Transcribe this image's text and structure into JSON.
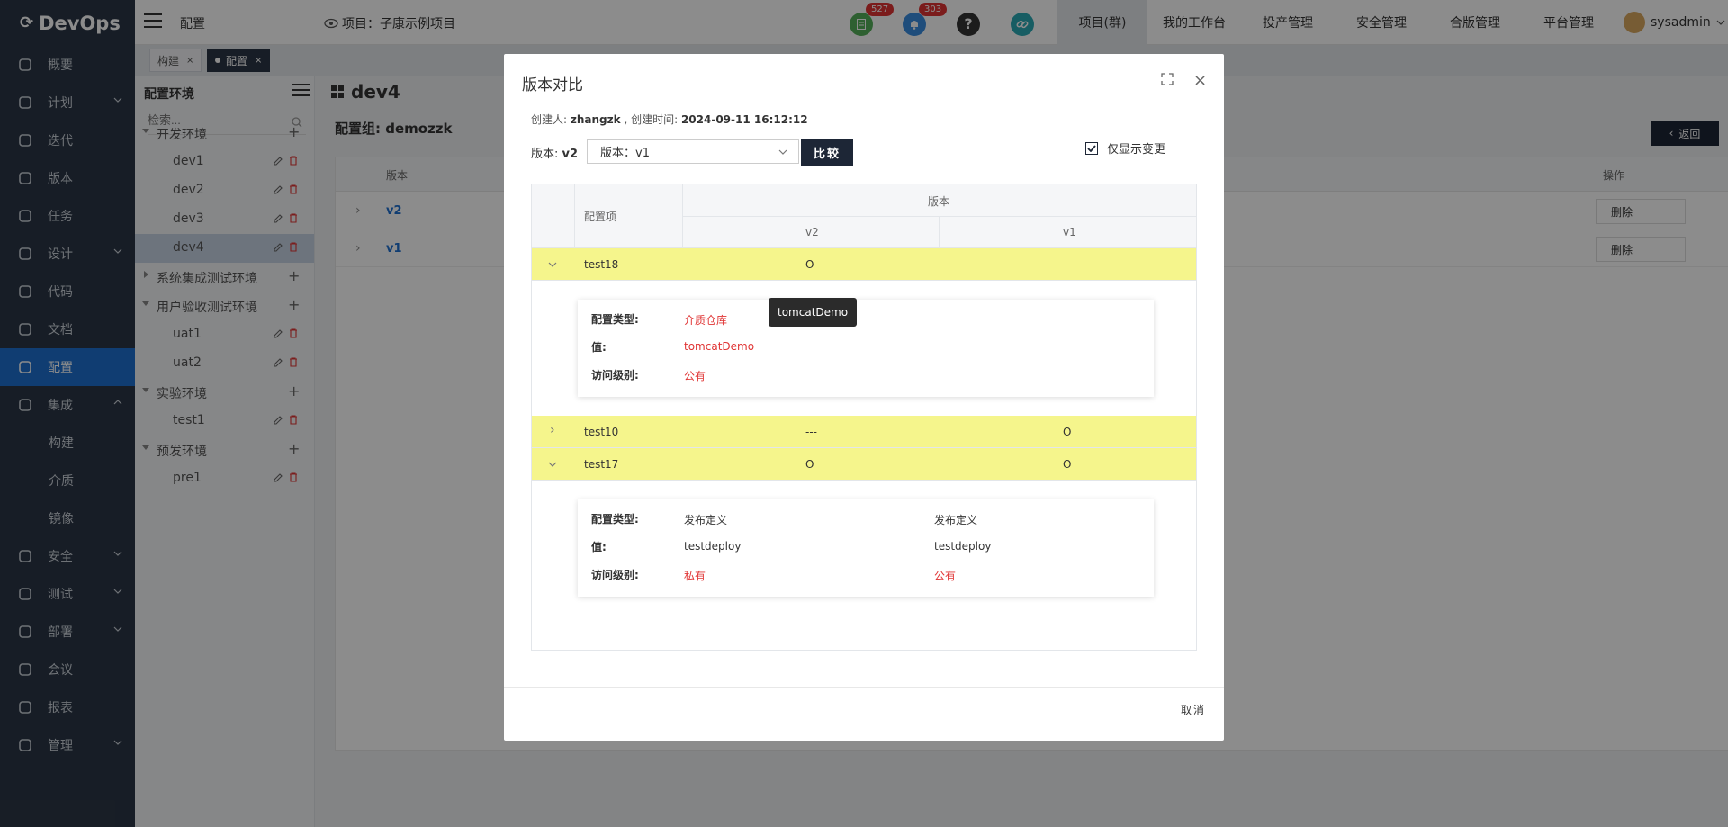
{
  "app": {
    "name": "DevOps"
  },
  "sidebar": {
    "items": [
      {
        "label": "概要",
        "icon": "dashboard-icon"
      },
      {
        "label": "计划",
        "icon": "plan-icon"
      },
      {
        "label": "迭代",
        "icon": "iteration-icon"
      },
      {
        "label": "版本",
        "icon": "version-icon"
      },
      {
        "label": "任务",
        "icon": "task-icon"
      },
      {
        "label": "设计",
        "icon": "design-icon"
      },
      {
        "label": "代码",
        "icon": "code-icon"
      },
      {
        "label": "文档",
        "icon": "document-icon"
      },
      {
        "label": "配置",
        "icon": "config-icon"
      },
      {
        "label": "集成",
        "icon": "integration-icon"
      },
      {
        "label": "构建",
        "icon": ""
      },
      {
        "label": "介质",
        "icon": ""
      },
      {
        "label": "镜像",
        "icon": ""
      },
      {
        "label": "安全",
        "icon": "security-icon"
      },
      {
        "label": "测试",
        "icon": "test-icon"
      },
      {
        "label": "部署",
        "icon": "deploy-icon"
      },
      {
        "label": "会议",
        "icon": "meeting-icon"
      },
      {
        "label": "报表",
        "icon": "report-icon"
      },
      {
        "label": "管理",
        "icon": "gear-icon"
      }
    ]
  },
  "topbar": {
    "page_title": "配置",
    "project_label": "项目：子康示例项目",
    "badge_doc": "527",
    "badge_bell": "303",
    "nav": [
      "项目(群)",
      "我的工作台",
      "投产管理",
      "安全管理",
      "合版管理",
      "平台管理"
    ],
    "user": "sysadmin"
  },
  "tabs": [
    {
      "label": "构建"
    },
    {
      "label": "配置"
    }
  ],
  "config_panel": {
    "title": "配置环境",
    "search_placeholder": "检索...",
    "tree": [
      {
        "label": "开发环境",
        "kind": "group"
      },
      {
        "label": "dev1",
        "kind": "leaf"
      },
      {
        "label": "dev2",
        "kind": "leaf"
      },
      {
        "label": "dev3",
        "kind": "leaf"
      },
      {
        "label": "dev4",
        "kind": "leaf"
      },
      {
        "label": "系统集成测试环境",
        "kind": "group"
      },
      {
        "label": "用户验收测试环境",
        "kind": "group"
      },
      {
        "label": "uat1",
        "kind": "leaf"
      },
      {
        "label": "uat2",
        "kind": "leaf"
      },
      {
        "label": "实验环境",
        "kind": "group"
      },
      {
        "label": "test1",
        "kind": "leaf"
      },
      {
        "label": "预发环境",
        "kind": "group"
      },
      {
        "label": "pre1",
        "kind": "leaf"
      }
    ]
  },
  "main": {
    "title": "dev4",
    "group_label": "配置组: demozzk",
    "back_label": "返回",
    "col_version": "版本",
    "col_ops": "操作",
    "rows": [
      "v2",
      "v1"
    ],
    "delete_label": "删除"
  },
  "modal": {
    "title": "版本对比",
    "creator_prefix": "创建人:",
    "creator": "zhangzk",
    "created_prefix": ", 创建时间:",
    "created_at": "2024-09-11 16:12:12",
    "version_prefix": "版本: ",
    "version_current": "v2",
    "select_value": "版本：v1",
    "compare_label": "比较",
    "only_changes_label": "仅显示变更",
    "only_changes_checked": true,
    "table": {
      "col_item": "配置项",
      "col_version_group": "版本",
      "col_v2": "v2",
      "col_v1": "v1",
      "rows": [
        {
          "name": "test18",
          "v2": "O",
          "v1": "---",
          "expanded": true
        },
        {
          "name": "test10",
          "v2": "---",
          "v1": "O",
          "expanded": false
        },
        {
          "name": "test17",
          "v2": "O",
          "v1": "O",
          "expanded": true
        }
      ]
    },
    "detail18": {
      "type_label": "配置类型:",
      "type_value": "介质仓库",
      "value_label": "值:",
      "value_value": "tomcatDemo",
      "access_label": "访问级别:",
      "access_value": "公有",
      "tooltip": "tomcatDemo"
    },
    "detail17": {
      "type_label": "配置类型:",
      "value_label": "值:",
      "access_label": "访问级别:",
      "v2_type": "发布定义",
      "v2_value": "testdeploy",
      "v2_access": "私有",
      "v1_type": "发布定义",
      "v1_value": "testdeploy",
      "v1_access": "公有"
    },
    "cancel_label": "取消"
  },
  "colors": {
    "sidebar": "#2b3645",
    "active": "#1e6fd0",
    "highlight": "#f5f58c",
    "danger": "#e03434"
  }
}
